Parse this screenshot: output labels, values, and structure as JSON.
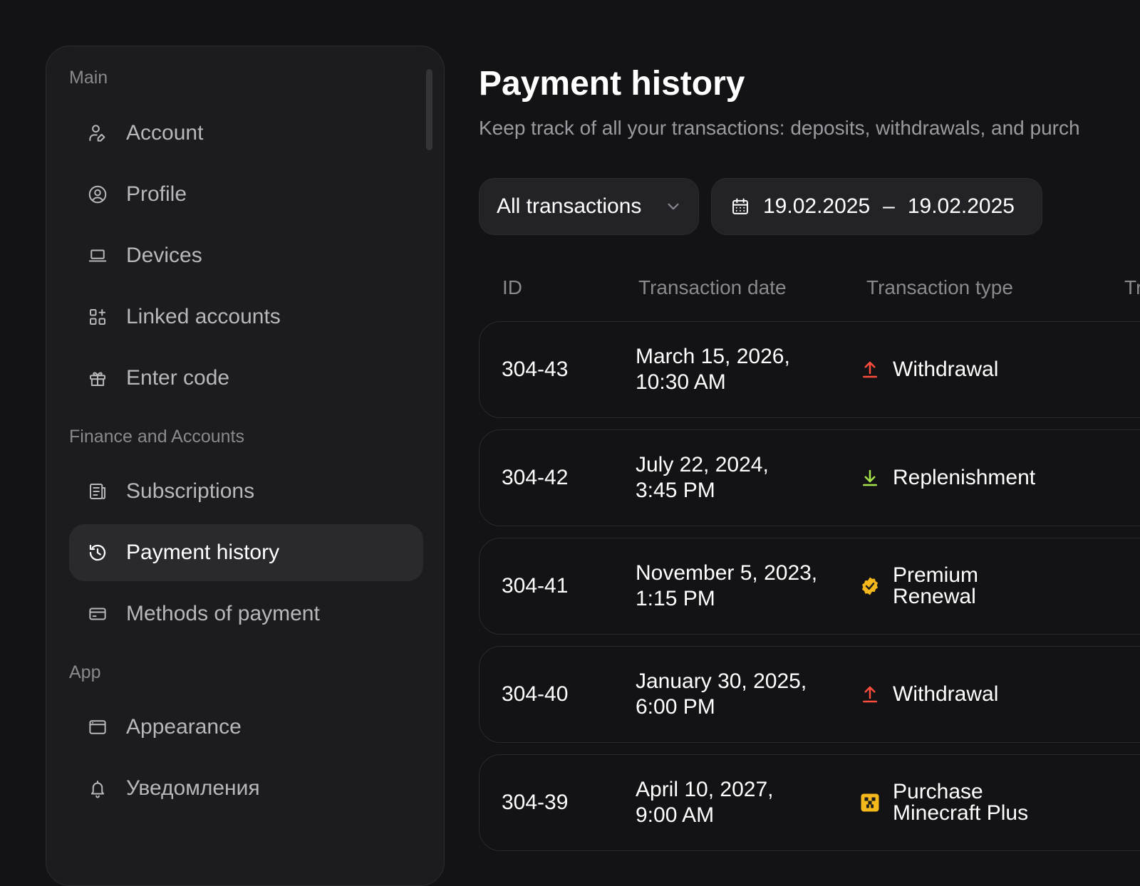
{
  "sidebar": {
    "sections": [
      {
        "label": "Main",
        "items": [
          {
            "label": "Account",
            "icon": "user-edit-icon"
          },
          {
            "label": "Profile",
            "icon": "user-circle-icon"
          },
          {
            "label": "Devices",
            "icon": "laptop-icon"
          },
          {
            "label": "Linked accounts",
            "icon": "apps-add-icon"
          },
          {
            "label": "Enter code",
            "icon": "gift-icon"
          }
        ]
      },
      {
        "label": "Finance and Accounts",
        "items": [
          {
            "label": "Subscriptions",
            "icon": "receipt-icon"
          },
          {
            "label": "Payment history",
            "icon": "history-icon",
            "active": true
          },
          {
            "label": "Methods of payment",
            "icon": "credit-card-icon"
          }
        ]
      },
      {
        "label": "App",
        "items": [
          {
            "label": "Appearance",
            "icon": "window-icon"
          },
          {
            "label": "Уведомления",
            "icon": "bell-icon"
          }
        ]
      }
    ]
  },
  "page": {
    "title": "Payment history",
    "subtitle": "Keep track of all your transactions: deposits, withdrawals, and purch"
  },
  "filters": {
    "type_label": "All transactions",
    "date_from": "19.02.2025",
    "date_separator": "–",
    "date_to": "19.02.2025"
  },
  "table": {
    "columns": [
      "ID",
      "Transaction date",
      "Transaction type",
      "Tr"
    ],
    "rows": [
      {
        "id": "304-43",
        "date_line1": "March 15, 2026,",
        "date_line2": "10:30 AM",
        "type": "Withdrawal",
        "type_icon": "arrow-up-icon"
      },
      {
        "id": "304-42",
        "date_line1": "July 22, 2024,",
        "date_line2": "3:45 PM",
        "type": "Replenishment",
        "type_icon": "arrow-down-icon"
      },
      {
        "id": "304-41",
        "date_line1": "November 5, 2023,",
        "date_line2": "1:15 PM",
        "type": "Premium Renewal",
        "type_icon": "verified-badge-icon"
      },
      {
        "id": "304-40",
        "date_line1": "January 30, 2025,",
        "date_line2": "6:00 PM",
        "type": "Withdrawal",
        "type_icon": "arrow-up-icon"
      },
      {
        "id": "304-39",
        "date_line1": "April 10, 2027,",
        "date_line2": "9:00 AM",
        "type": "Purchase Minecraft Plus",
        "type_icon": "minecraft-icon"
      }
    ]
  },
  "colors": {
    "background": "#131215",
    "sidebar": "#1c1b1e",
    "withdrawal": "#ff4d3d",
    "replenishment": "#a6e34b",
    "premium": "#f5b81c"
  }
}
